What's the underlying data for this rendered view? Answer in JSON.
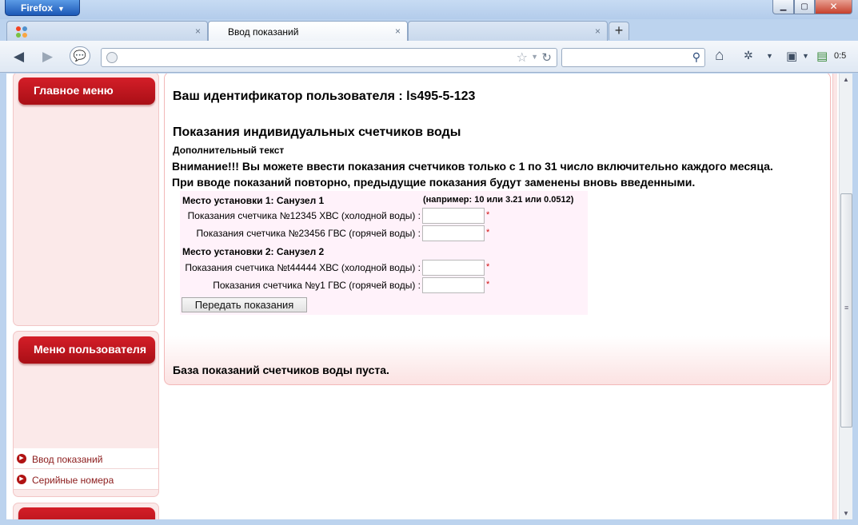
{
  "browser": {
    "menu_button": "Firefox",
    "tabs": [
      {
        "label": "",
        "close": "×"
      },
      {
        "label": "Ввод показаний",
        "close": "×"
      },
      {
        "label": "",
        "close": "×"
      }
    ],
    "new_tab": "+",
    "url": "",
    "search": "",
    "clock_text": "0:5"
  },
  "sidebar": {
    "main_menu_title": "Главное меню",
    "user_menu_title": "Меню пользователя",
    "user_menu_items": [
      "Ввод показаний",
      "Серийные номера"
    ]
  },
  "content": {
    "user_id": "Ваш идентификатор пользователя : ls495-5-123",
    "section_title": "Показания индивидуальных счетчиков воды",
    "extra_text": "Дополнительный текст",
    "warning_1": "Внимание!!! Вы можете ввести показания счетчиков только с 1 по 31 число включительно каждого месяца.",
    "warning_2": "При вводе показаний повторно, предыдущие показания будут заменены вновь введенными.",
    "form": {
      "example_hint": "(например: 10 или 3.21 или 0.0512)",
      "locations": [
        {
          "label": "Место установки 1: Санузел 1",
          "meters": [
            {
              "label": "Показания счетчика №12345 ХВС (холодной воды) :",
              "value": ""
            },
            {
              "label": "Показания счетчика №23456 ГВС (горячей воды) :",
              "value": ""
            }
          ]
        },
        {
          "label": "Место установки 2: Санузел 2",
          "meters": [
            {
              "label": "Показания счетчика №t44444 ХВС (холодной воды) :",
              "value": ""
            },
            {
              "label": "Показания счетчика №у1 ГВС (горячей воды) :",
              "value": ""
            }
          ]
        }
      ],
      "required_mark": "*",
      "submit_label": "Передать показания"
    },
    "empty_db": "База показаний счетчиков воды пуста."
  }
}
